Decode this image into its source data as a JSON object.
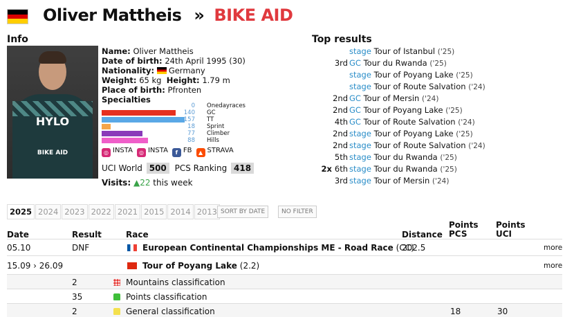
{
  "header": {
    "rider_name": "Oliver Mattheis",
    "separator": "»",
    "team": "BIKE AID",
    "nationality_flag": "germany-flag-icon"
  },
  "info": {
    "heading": "Info",
    "name_label": "Name:",
    "name": "Oliver Mattheis",
    "dob_label": "Date of birth:",
    "dob": "24th April 1995 (30)",
    "nationality_label": "Nationality:",
    "nationality": "Germany",
    "weight_label": "Weight:",
    "weight": "65 kg",
    "height_label": "Height:",
    "height": "1.79 m",
    "pob_label": "Place of birth:",
    "pob": "Pfronten",
    "specialties_label": "Specialties"
  },
  "specialties": [
    {
      "label": "Onedayraces",
      "value": "0",
      "fraction": 0.0,
      "color": "#e53935"
    },
    {
      "label": "GC",
      "value": "140",
      "fraction": 0.89,
      "color": "#e53020"
    },
    {
      "label": "TT",
      "value": "157",
      "fraction": 1.0,
      "color": "#5aa8e6"
    },
    {
      "label": "Sprint",
      "value": "18",
      "fraction": 0.11,
      "color": "#f5a54a"
    },
    {
      "label": "Climber",
      "value": "77",
      "fraction": 0.49,
      "color": "#8a3ab9"
    },
    {
      "label": "Hills",
      "value": "88",
      "fraction": 0.56,
      "color": "#ef5fc9"
    }
  ],
  "social": [
    {
      "label": "INSTA",
      "icon": "instagram-icon",
      "color": "#d62976"
    },
    {
      "label": "INSTA",
      "icon": "instagram-icon",
      "color": "#d62976"
    },
    {
      "label": "FB",
      "icon": "facebook-icon",
      "color": "#3b5998"
    },
    {
      "label": "STRAVA",
      "icon": "strava-icon",
      "color": "#fc4c02"
    }
  ],
  "ranking": {
    "uci_label": "UCI World",
    "uci_value": "500",
    "pcs_label": "PCS Ranking",
    "pcs_value": "418"
  },
  "visits": {
    "label": "Visits:",
    "arrow": "▲",
    "count": "22",
    "suffix": "this week"
  },
  "top_results": {
    "heading": "Top results",
    "items": [
      {
        "pos": "",
        "kind": "stage",
        "race": "Tour of Istanbul",
        "year": "('25)"
      },
      {
        "pos": "3rd",
        "kind": "GC",
        "race": "Tour du Rwanda",
        "year": "('25)"
      },
      {
        "pos": "",
        "kind": "stage",
        "race": "Tour of Poyang Lake",
        "year": "('25)"
      },
      {
        "pos": "",
        "kind": "stage",
        "race": "Tour of Route Salvation",
        "year": "('24)"
      },
      {
        "pos": "2nd",
        "kind": "GC",
        "race": "Tour of Mersin",
        "year": "('24)"
      },
      {
        "pos": "2nd",
        "kind": "GC",
        "race": "Tour of Poyang Lake",
        "year": "('25)"
      },
      {
        "pos": "4th",
        "kind": "GC",
        "race": "Tour of Route Salvation",
        "year": "('24)"
      },
      {
        "pos": "2nd",
        "kind": "stage",
        "race": "Tour of Poyang Lake",
        "year": "('25)"
      },
      {
        "pos": "2nd",
        "kind": "stage",
        "race": "Tour of Route Salvation",
        "year": "('24)"
      },
      {
        "pos": "5th",
        "kind": "stage",
        "race": "Tour du Rwanda",
        "year": "('25)"
      },
      {
        "pos": "6th",
        "prefix": "2x",
        "kind": "stage",
        "race": "Tour du Rwanda",
        "year": "('25)"
      },
      {
        "pos": "3rd",
        "kind": "stage",
        "race": "Tour of Mersin",
        "year": "('24)"
      }
    ]
  },
  "season_tabs": [
    "2025",
    "2024",
    "2023",
    "2022",
    "2021",
    "2015",
    "2014",
    "2013"
  ],
  "active_tab": "2025",
  "buttons": {
    "sort": "SORT BY DATE",
    "filter": "NO FILTER"
  },
  "table": {
    "headers": {
      "date": "Date",
      "result": "Result",
      "race": "Race",
      "distance": "Distance",
      "points_pcs": "Points PCS",
      "points_uci": "Points UCI",
      "points_word": "Points",
      "pcs": "PCS",
      "uci": "UCI"
    },
    "rows": [
      {
        "date": "05.10",
        "result": "DNF",
        "race": "European Continental Championships ME - Road Race",
        "class": "(CC)",
        "flag": "france-flag-icon",
        "distance": "202.5",
        "pcs": "",
        "uci": "",
        "more": "more",
        "bold": true
      },
      {
        "date": "15.09 › 26.09",
        "result": "",
        "race": "Tour of Poyang Lake",
        "class": "(2.2)",
        "flag": "china-flag-icon",
        "distance": "",
        "pcs": "",
        "uci": "",
        "more": "more",
        "bold": true
      },
      {
        "date": "",
        "result": "2",
        "race": "Mountains classification",
        "jersey": "polka-dot-jersey-icon",
        "pcs": "",
        "uci": ""
      },
      {
        "date": "",
        "result": "35",
        "race": "Points classification",
        "jersey": "green-jersey-icon",
        "pcs": "",
        "uci": ""
      },
      {
        "date": "",
        "result": "2",
        "race": "General classification",
        "jersey": "yellow-jersey-icon",
        "pcs": "18",
        "uci": "30"
      }
    ]
  }
}
